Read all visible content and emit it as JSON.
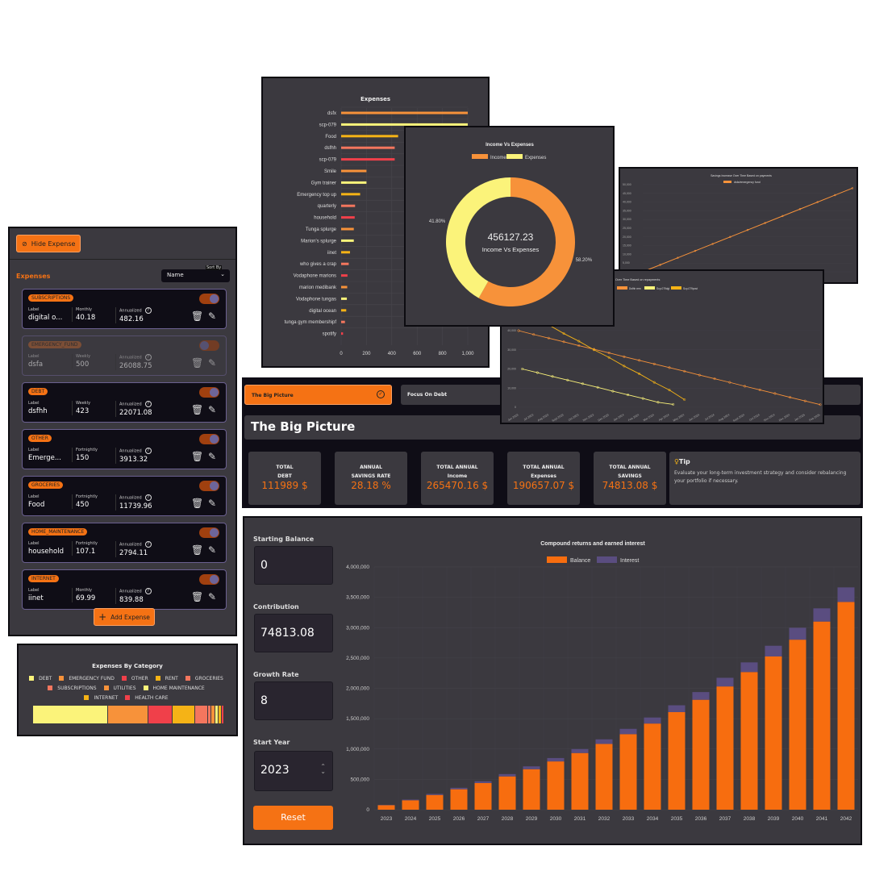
{
  "expenses_panel": {
    "hide_label": "Hide Expense",
    "title": "Expenses",
    "sort_label": "Sort By",
    "sort_value": "Name",
    "add_label": "Add Expense",
    "colors": {
      "accent": "#f57214",
      "card": "#0f0d16",
      "toggle_knob": "#6d659a"
    },
    "items": [
      {
        "category": "SUBSCRIPTIONS",
        "label_h": "Label",
        "label": "digital o...",
        "freq": "Monthly",
        "amount": "40.18",
        "ann_h": "Annualized",
        "annualized": "482.16",
        "enabled": true
      },
      {
        "category": "EMERGENCY_FUND",
        "label_h": "Label",
        "label": "dsfa",
        "freq": "Weekly",
        "amount": "500",
        "ann_h": "Annualized",
        "annualized": "26088.75",
        "enabled": false
      },
      {
        "category": "DEBT",
        "label_h": "Label",
        "label": "dsfhh",
        "freq": "Weekly",
        "amount": "423",
        "ann_h": "Annualized",
        "annualized": "22071.08",
        "enabled": true
      },
      {
        "category": "OTHER",
        "label_h": "Label",
        "label": "Emerge...",
        "freq": "Fortnightly",
        "amount": "150",
        "ann_h": "Annualized",
        "annualized": "3913.32",
        "enabled": true
      },
      {
        "category": "GROCERIES",
        "label_h": "Label",
        "label": "Food",
        "freq": "Fortnightly",
        "amount": "450",
        "ann_h": "Annualized",
        "annualized": "11739.96",
        "enabled": true
      },
      {
        "category": "HOME_MAINTENANCE",
        "label_h": "Label",
        "label": "household",
        "freq": "Fortnightly",
        "amount": "107.1",
        "ann_h": "Annualized",
        "annualized": "2794.11",
        "enabled": true
      },
      {
        "category": "INTERNET",
        "label_h": "Label",
        "label": "iinet",
        "freq": "Monthly",
        "amount": "69.99",
        "ann_h": "Annualized",
        "annualized": "839.88",
        "enabled": true
      }
    ]
  },
  "chart_data": [
    {
      "id": "category",
      "type": "bar",
      "orientation": "stacked-horizontal",
      "title": "Expenses By Category",
      "legend": "top",
      "series": [
        {
          "name": "DEBT",
          "value": 40.7,
          "color": "#fbf37a"
        },
        {
          "name": "EMERGENCY FUND",
          "value": 21.6,
          "color": "#f7923a"
        },
        {
          "name": "OTHER",
          "value": 12.6,
          "color": "#f0404a"
        },
        {
          "name": "RENT",
          "value": 12.0,
          "color": "#f5b316"
        },
        {
          "name": "GROCERIES",
          "value": 6.5,
          "color": "#f4765e"
        },
        {
          "name": "SUBSCRIPTIONS",
          "value": 1.5,
          "color": "#f4765e"
        },
        {
          "name": "UTILITIES",
          "value": 1.5,
          "color": "#f7923a"
        },
        {
          "name": "HOME MAINTENANCE",
          "value": 1.5,
          "color": "#fbf37a"
        },
        {
          "name": "INTERNET",
          "value": 1.0,
          "color": "#f5b316"
        },
        {
          "name": "HEALTH CARE",
          "value": 1.1,
          "color": "#f0404a"
        }
      ]
    },
    {
      "id": "expenses",
      "type": "bar",
      "orientation": "horizontal",
      "title": "Expenses",
      "xlim": [
        0,
        1000
      ],
      "xticks": [
        "0",
        "200",
        "400",
        "600",
        "800",
        "1,000"
      ],
      "grid": true,
      "categories": [
        "dsfx",
        "scp-079",
        "Food",
        "dsfhh",
        "scp-079",
        "Smile",
        "Gym trainer",
        "Emergency top up",
        "quarterly",
        "household",
        "Tunga splurge",
        "Marion's splurge",
        "iinet",
        "who gives a crap",
        "Vodaphone marions",
        "marion medibank",
        "Vodaphone tungas",
        "digital ocean",
        "tunga gym membershipf",
        "spotify"
      ],
      "values": [
        1000,
        1000,
        450,
        423,
        423,
        200,
        200,
        150,
        110,
        107.1,
        100,
        100,
        69.99,
        60,
        50,
        48,
        45,
        40.18,
        30,
        15
      ],
      "colors": [
        "#f7923a",
        "#fbf37a",
        "#f5b316",
        "#f4765e",
        "#f0404a"
      ]
    },
    {
      "id": "donut",
      "type": "pie",
      "title": "Income Vs Expenses",
      "center_value": "456127.23",
      "center_label": "Income Vs Expenses",
      "legend": "top",
      "series": [
        {
          "name": "Income",
          "value": 58.2,
          "label": "58.20%",
          "color": "#f7923a"
        },
        {
          "name": "Expenses",
          "value": 41.8,
          "label": "41.80%",
          "color": "#fbf37a"
        }
      ]
    },
    {
      "id": "savings",
      "type": "line",
      "title": "Savings Increase Over Time Based on payments",
      "legend": "top",
      "series": [
        {
          "name": "dsfa/emergency fund",
          "color": "#f7923a",
          "values": [
            0,
            4000,
            8000,
            12000,
            16000,
            20000,
            24000,
            28000,
            32000,
            36000,
            40000,
            44000,
            48000
          ]
        }
      ],
      "ylim": [
        0,
        50000
      ],
      "yticks": [
        "0",
        "5,000",
        "10,000",
        "15,000",
        "20,000",
        "25,000",
        "30,000",
        "35,000",
        "40,000",
        "45,000",
        "50,000"
      ]
    },
    {
      "id": "debt",
      "type": "line",
      "title": "Debt Reduction Over Time Based on repayments",
      "legend": "top",
      "ylim": [
        0,
        40000
      ],
      "yticks": [
        "0",
        "10,000",
        "20,000",
        "30,000",
        "40,000"
      ],
      "grid": true,
      "x": [
        "Jun 2023",
        "Jul 2023",
        "Aug 2023",
        "Sept 2023",
        "Oct 2023",
        "Nov 2023",
        "Dec 2023",
        "Jan 2024",
        "Feb 2024",
        "Mar 2024",
        "Apr 2024",
        "May 2024",
        "Jun 2024",
        "Jul 2024",
        "Aug 2024",
        "Sept 2024",
        "Oct 2024",
        "Nov 2024",
        "Dec 2024",
        "Jan 2025",
        "Feb 2025"
      ],
      "series": [
        {
          "name": "Dsfhh rem",
          "color": "#f7923a",
          "values": [
            40000,
            38000,
            36100,
            34200,
            32200,
            30300,
            28400,
            26400,
            24500,
            22600,
            20700,
            18800,
            16800,
            14900,
            13000,
            11000,
            9100,
            7200,
            5200,
            3300,
            1400
          ]
        },
        {
          "name": "Scp-079dgl",
          "color": "#fbf37a",
          "values": [
            20000,
            18100,
            16100,
            14200,
            12300,
            10400,
            8400,
            6500,
            4600,
            2600,
            1500
          ]
        },
        {
          "name": "Scp-079post",
          "color": "#f5b316",
          "values": [
            52000,
            47500,
            43000,
            38500,
            34500,
            30000,
            26000,
            21500,
            17500,
            13000,
            9000,
            4000
          ]
        }
      ]
    },
    {
      "id": "compound",
      "type": "bar",
      "stacked": true,
      "title": "Compound returns and earned interest",
      "legend": "top",
      "ylim": [
        0,
        4000000
      ],
      "grid": true,
      "yticks": [
        "0",
        "500,000",
        "1,000,000",
        "1,500,000",
        "2,000,000",
        "2,500,000",
        "3,000,000",
        "3,500,000",
        "4,000,000"
      ],
      "categories": [
        "2023",
        "2024",
        "2025",
        "2026",
        "2027",
        "2028",
        "2029",
        "2030",
        "2031",
        "2032",
        "2033",
        "2034",
        "2035",
        "2036",
        "2037",
        "2038",
        "2039",
        "2040",
        "2041",
        "2042"
      ],
      "series": [
        {
          "name": "Balance",
          "color": "#f76d0f",
          "values": [
            74813,
            155611,
            242843,
            337107,
            438928,
            548830,
            667557,
            795786,
            934264,
            1083816,
            1245264,
            1419728,
            1608107,
            1811596,
            2031325,
            2268631,
            2524939,
            2801747,
            3100683,
            3423591
          ]
        },
        {
          "name": "Interest",
          "color": "#5a4d80",
          "values": [
            5237,
            10893,
            16999,
            23597,
            30725,
            38418,
            46729,
            55705,
            65398,
            75867,
            87168,
            99381,
            112567,
            126812,
            142193,
            158804,
            176746,
            196122,
            217048,
            239651
          ]
        }
      ]
    }
  ],
  "big_picture": {
    "tabs": [
      {
        "label": "The Big Picture",
        "active": true
      },
      {
        "label": "Focus On Debt",
        "active": false
      }
    ],
    "heading": "The Big Picture",
    "stats": [
      {
        "l1": "TOTAL",
        "l2": "DEBT",
        "value": "111989 $"
      },
      {
        "l1": "ANNUAL",
        "l2": "SAVINGS RATE",
        "value": "28.18 %"
      },
      {
        "l1": "TOTAL ANNUAL",
        "l2": "Income",
        "value": "265470.16 $"
      },
      {
        "l1": "TOTAL ANNUAL",
        "l2": "Expenses",
        "value": "190657.07 $"
      },
      {
        "l1": "TOTAL ANNUAL",
        "l2": "SAVINGS",
        "value": "74813.08 $"
      }
    ],
    "tip_title": "Tip",
    "tip_text": "Evaluate your long-term investment strategy and consider rebalancing your portfolio if necessary."
  },
  "calculator": {
    "starting_balance_label": "Starting Balance",
    "starting_balance": "0",
    "contribution_label": "Contribution",
    "contribution": "74813.08",
    "growth_label": "Growth Rate",
    "growth": "8",
    "start_year_label": "Start Year",
    "start_year": "2023",
    "reset_label": "Reset"
  }
}
